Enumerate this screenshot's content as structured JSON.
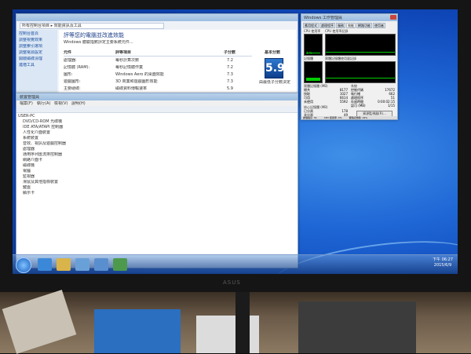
{
  "perf_window": {
    "address": "所有控制台項目 ▸ 效能資訊及工具",
    "heading": "評等您的電腦並改進效能",
    "intro": "Windows 體驗指數評定主要系統元件...",
    "sidebar": [
      "控制台首頁",
      "調整視覺效果",
      "調整索引選項",
      "調整電源設定",
      "開啟磁碟清理",
      "進階工具"
    ],
    "col_component": "元件",
    "col_rated": "評等項目",
    "col_subscore": "子分數",
    "col_base": "基本分數",
    "rows": [
      {
        "name": "處理器:",
        "desc": "每秒計算次數",
        "score": "7.2"
      },
      {
        "name": "記憶體 (RAM):",
        "desc": "每秒記憶體作業",
        "score": "7.2"
      },
      {
        "name": "圖形:",
        "desc": "Windows Aero 的桌面效能",
        "score": "7.3"
      },
      {
        "name": "遊戲圖形:",
        "desc": "3D 商業和遊戲圖形效能",
        "score": "7.3"
      },
      {
        "name": "主要硬碟:",
        "desc": "磁碟資料傳輸速率",
        "score": "5.9"
      }
    ],
    "base_score": "5.9",
    "base_note": "由最低子分數決定"
  },
  "device_manager": {
    "title": "裝置管理員",
    "menu": [
      "檔案(F)",
      "執行(A)",
      "檢視(V)",
      "說明(H)"
    ],
    "root": "USER-PC",
    "devices": [
      "DVD/CD-ROM 光碟機",
      "IDE ATA/ATAPI 控制器",
      "人性化介面裝置",
      "系統裝置",
      "音效、視訊及遊戲控制器",
      "處理器",
      "通用序列匯流排控制器",
      "網路介面卡",
      "磁碟機",
      "電腦",
      "監視器",
      "滑鼠及其他指標裝置",
      "鍵盤",
      "顯示卡"
    ]
  },
  "task_manager": {
    "title": "Windows 工作管理員",
    "tabs": [
      "應用程式",
      "處理程序",
      "服務",
      "效能",
      "網路功能",
      "使用者"
    ],
    "active_tab": "效能",
    "cpu_label": "CPU 使用率",
    "cpu_history_label": "CPU 使用率記錄",
    "cpu_value": "4 %",
    "mem_label": "記憶體",
    "mem_history_label": "實體記憶體使用量記錄",
    "phys_label": "實體記憶體 (MB)",
    "phys_rows": [
      [
        "總共",
        "8177"
      ],
      [
        "快取",
        "1027"
      ],
      [
        "可用",
        "6614"
      ],
      [
        "未使用",
        "5592"
      ]
    ],
    "system_label": "系統",
    "system_rows": [
      [
        "控制代碼",
        "17672"
      ],
      [
        "執行緒",
        "662"
      ],
      [
        "處理程序",
        "51"
      ],
      [
        "存留時間",
        "0:00:02:15"
      ],
      [
        "認可 (MB)",
        "1/15"
      ]
    ],
    "kernel_label": "核心記憶體 (MB)",
    "kernel_rows": [
      [
        "已分頁",
        "178"
      ],
      [
        "非分頁",
        "49"
      ]
    ],
    "resmon_button": "資源監視器(R)...",
    "status_processes": "處理程序: 51",
    "status_cpu": "CPU 使用率: 4%",
    "status_mem": "實體記憶體: 19%",
    "cpu_fraction": 0.04,
    "mem_fraction": 0.19
  },
  "taskbar": {
    "time": "下午 06:27",
    "date": "2015/6/9"
  },
  "monitor": {
    "brand": "ASUS"
  },
  "colors": {
    "desktop_blue": "#1f67d6",
    "graph_green": "#00cc00"
  }
}
